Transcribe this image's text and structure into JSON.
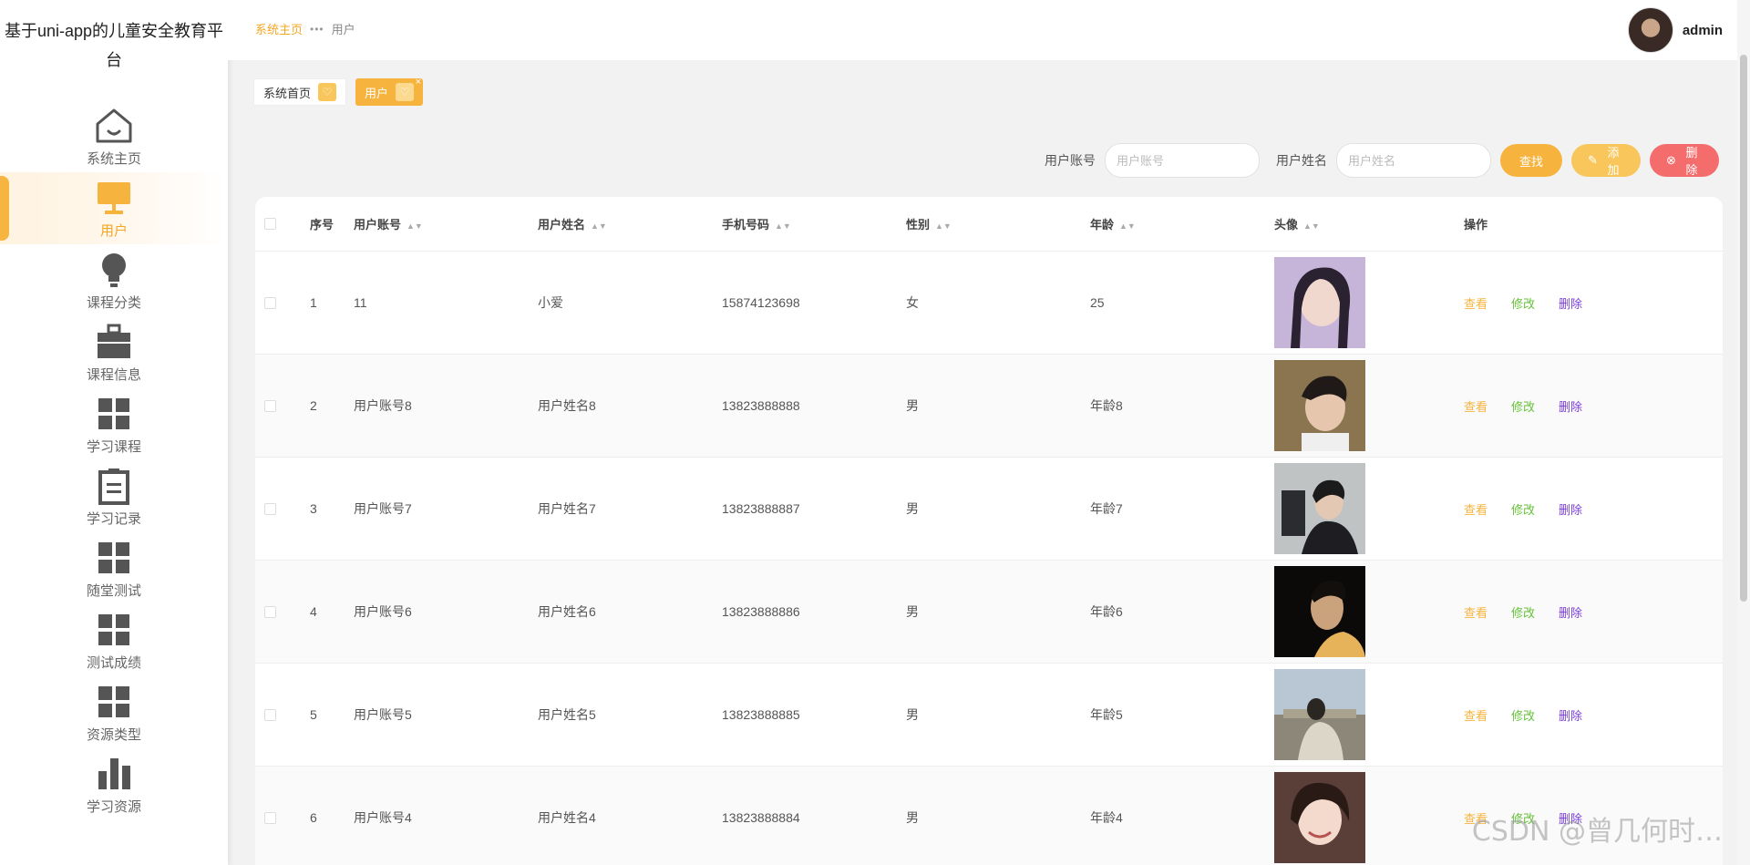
{
  "app": {
    "title": "基于uni-app的儿童安全教育平台"
  },
  "sidebar": {
    "items": [
      {
        "label": "系统主页",
        "icon": "house-icon",
        "active": false
      },
      {
        "label": "用户",
        "icon": "monitor-icon",
        "active": true
      },
      {
        "label": "课程分类",
        "icon": "lightbulb-icon",
        "active": false
      },
      {
        "label": "课程信息",
        "icon": "briefcase-icon",
        "active": false
      },
      {
        "label": "学习课程",
        "icon": "grid-icon",
        "active": false
      },
      {
        "label": "学习记录",
        "icon": "clipboard-icon",
        "active": false
      },
      {
        "label": "随堂测试",
        "icon": "grid-icon",
        "active": false
      },
      {
        "label": "测试成绩",
        "icon": "grid-icon",
        "active": false
      },
      {
        "label": "资源类型",
        "icon": "grid-icon",
        "active": false
      },
      {
        "label": "学习资源",
        "icon": "bar-chart-icon",
        "active": false
      }
    ]
  },
  "header": {
    "breadcrumb": {
      "home": "系统主页",
      "separator": "•••",
      "current": "用户"
    },
    "user": {
      "name": "admin"
    }
  },
  "tags": [
    {
      "label": "系统首页",
      "active": false
    },
    {
      "label": "用户",
      "active": true
    }
  ],
  "search": {
    "account_label": "用户账号",
    "account_placeholder": "用户账号",
    "name_label": "用户姓名",
    "name_placeholder": "用户姓名",
    "search_btn": "查找",
    "add_btn": "添加",
    "delete_btn": "删除"
  },
  "table": {
    "columns": [
      "序号",
      "用户账号",
      "用户姓名",
      "手机号码",
      "性别",
      "年龄",
      "头像",
      "操作"
    ],
    "rows": [
      {
        "idx": "1",
        "account": "11",
        "name": "小爱",
        "phone": "15874123698",
        "sex": "女",
        "age": "25"
      },
      {
        "idx": "2",
        "account": "用户账号8",
        "name": "用户姓名8",
        "phone": "13823888888",
        "sex": "男",
        "age": "年龄8"
      },
      {
        "idx": "3",
        "account": "用户账号7",
        "name": "用户姓名7",
        "phone": "13823888887",
        "sex": "男",
        "age": "年龄7"
      },
      {
        "idx": "4",
        "account": "用户账号6",
        "name": "用户姓名6",
        "phone": "13823888886",
        "sex": "男",
        "age": "年龄6"
      },
      {
        "idx": "5",
        "account": "用户账号5",
        "name": "用户姓名5",
        "phone": "13823888885",
        "sex": "男",
        "age": "年龄5"
      },
      {
        "idx": "6",
        "account": "用户账号4",
        "name": "用户姓名4",
        "phone": "13823888884",
        "sex": "男",
        "age": "年龄4"
      }
    ],
    "ops": {
      "view": "查看",
      "edit": "修改",
      "delete": "删除"
    }
  },
  "watermark": "CSDN @曾几何时…",
  "colors": {
    "accent": "#f6b43f",
    "danger": "#f56c6c",
    "edit": "#67c23a",
    "delete_link": "#7b3fd6"
  }
}
